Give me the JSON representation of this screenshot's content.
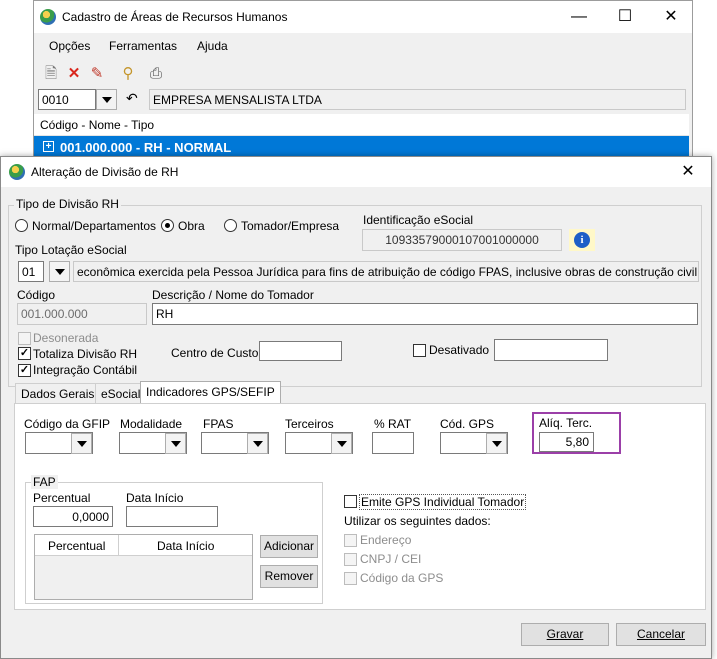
{
  "bg_window": {
    "title": "Cadastro de Áreas de Recursos Humanos",
    "menu": [
      "Opções",
      "Ferramentas",
      "Ajuda"
    ],
    "company_code": "0010",
    "company_name": "EMPRESA MENSALISTA LTDA",
    "list_header": "Código - Nome - Tipo",
    "selected_row": "001.000.000 - RH - NORMAL",
    "selected_color": "#0078d7"
  },
  "dialog": {
    "title": "Alteração de Divisão de RH",
    "tipo_divisao_label": "Tipo de Divisão RH",
    "radio_options": [
      "Normal/Departamentos",
      "Obra",
      "Tomador/Empresa"
    ],
    "selected_radio": "Obra",
    "identificacao_label": "Identificação eSocial",
    "identificacao_value": "10933579000107001000000",
    "tipo_lotacao_label": "Tipo Lotação eSocial",
    "tipo_lotacao_code": "01",
    "tipo_lotacao_desc": "econômica exercida pela Pessoa Jurídica para fins de atribuição de código FPAS, inclusive obras de construção civil própria",
    "codigo_label": "Código",
    "codigo_value": "001.000.000",
    "descricao_label": "Descrição / Nome do Tomador",
    "descricao_value": "RH",
    "desonerada_label": "Desonerada",
    "totaliza_label": "Totaliza Divisão RH",
    "integracao_label": "Integração Contábil",
    "centro_custo_label": "Centro de Custo",
    "desativado_label": "Desativado",
    "tabs": [
      "Dados Gerais",
      "eSocial",
      "Indicadores GPS/SEFIP"
    ],
    "gps": {
      "codigo_gfip_label": "Código da GFIP",
      "modalidade_label": "Modalidade",
      "fpas_label": "FPAS",
      "terceiros_label": "Terceiros",
      "rat_label": "% RAT",
      "cod_gps_label": "Cód. GPS",
      "aliq_terc_label": "Alíq. Terc.",
      "aliq_terc_value": "5,80",
      "highlight_color": "#9b3fa8"
    },
    "fap": {
      "title": "FAP",
      "percentual_label": "Percentual",
      "percentual_value": "0,0000",
      "data_inicio_label": "Data Início",
      "table_headers": [
        "Percentual",
        "Data Início"
      ],
      "adicionar": "Adicionar",
      "remover": "Remover"
    },
    "emite_label": "Emite GPS Individual Tomador",
    "utilizar_label": "Utilizar os seguintes dados:",
    "utilizar_options": [
      "Endereço",
      "CNPJ / CEI",
      "Código da GPS"
    ],
    "gravar": "Gravar",
    "cancelar": "Cancelar"
  }
}
